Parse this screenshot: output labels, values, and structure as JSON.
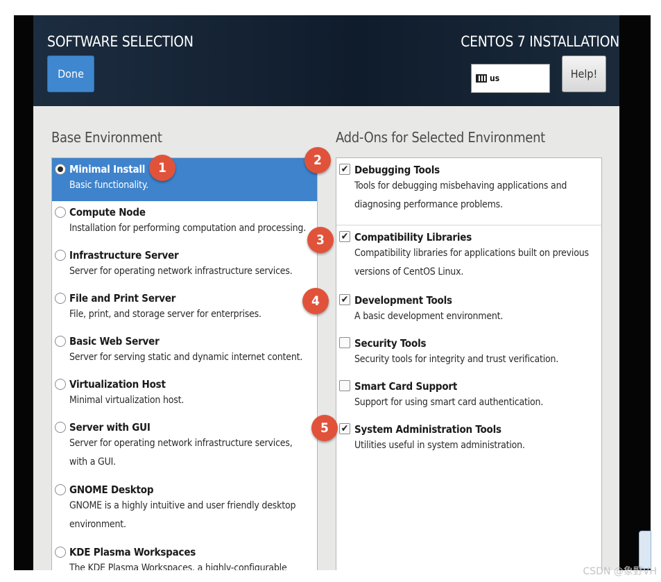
{
  "header": {
    "title": "SOFTWARE SELECTION",
    "subtitle": "CENTOS 7 INSTALLATION",
    "done_label": "Done",
    "keyboard_layout": "us",
    "help_label": "Help!"
  },
  "base_environment": {
    "heading": "Base Environment",
    "items": [
      {
        "name": "Minimal Install",
        "desc": "Basic functionality.",
        "selected": true
      },
      {
        "name": "Compute Node",
        "desc": "Installation for performing computation and processing.",
        "selected": false
      },
      {
        "name": "Infrastructure Server",
        "desc": "Server for operating network infrastructure services.",
        "selected": false
      },
      {
        "name": "File and Print Server",
        "desc": "File, print, and storage server for enterprises.",
        "selected": false
      },
      {
        "name": "Basic Web Server",
        "desc": "Server for serving static and dynamic internet content.",
        "selected": false
      },
      {
        "name": "Virtualization Host",
        "desc": "Minimal virtualization host.",
        "selected": false
      },
      {
        "name": "Server with GUI",
        "desc": "Server for operating network infrastructure services, with a GUI.",
        "selected": false
      },
      {
        "name": "GNOME Desktop",
        "desc": "GNOME is a highly intuitive and user friendly desktop environment.",
        "selected": false
      },
      {
        "name": "KDE Plasma Workspaces",
        "desc": "The KDE Plasma Workspaces, a highly-configurable",
        "selected": false
      }
    ]
  },
  "addons": {
    "heading": "Add-Ons for Selected Environment",
    "items": [
      {
        "name": "Debugging Tools",
        "desc": "Tools for debugging misbehaving applications and diagnosing performance problems.",
        "checked": true
      },
      {
        "name": "Compatibility Libraries",
        "desc": "Compatibility libraries for applications built on previous versions of CentOS Linux.",
        "checked": true
      },
      {
        "name": "Development Tools",
        "desc": "A basic development environment.",
        "checked": true
      },
      {
        "name": "Security Tools",
        "desc": "Security tools for integrity and trust verification.",
        "checked": false
      },
      {
        "name": "Smart Card Support",
        "desc": "Support for using smart card authentication.",
        "checked": false
      },
      {
        "name": "System Administration Tools",
        "desc": "Utilities useful in system administration.",
        "checked": true
      }
    ]
  },
  "annotations": [
    "1",
    "2",
    "3",
    "4",
    "5"
  ],
  "check_glyph": "✔",
  "watermark": "CSDN @象野VH",
  "colors": {
    "accent": "#3e83cc",
    "badge": "#e0533a",
    "header": "#142234"
  }
}
